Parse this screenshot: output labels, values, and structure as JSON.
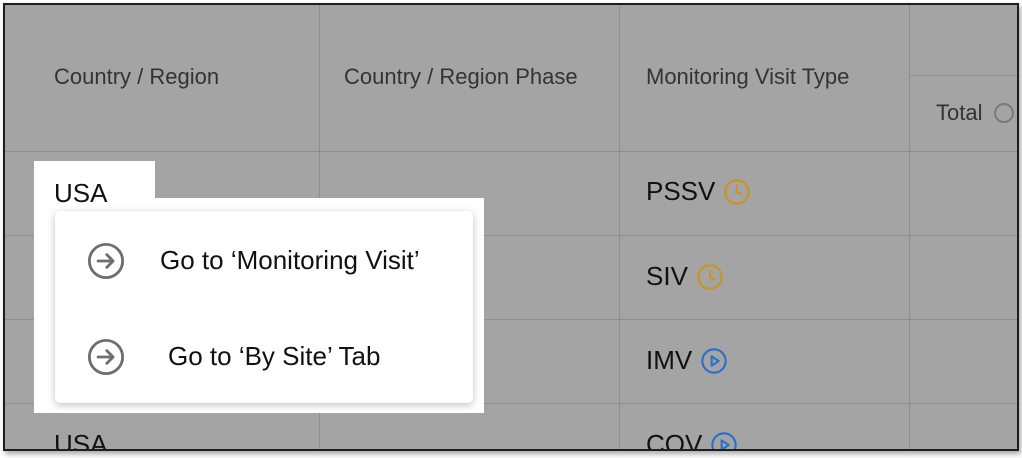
{
  "table": {
    "headers": {
      "country_region": "Country / Region",
      "country_region_phase": "Country / Region Phase",
      "monitoring_visit_type": "Monitoring Visit Type",
      "total": "Total"
    },
    "rows": [
      {
        "country": "USA",
        "visit_type": "PSSV",
        "status_icon": "clock-icon"
      },
      {
        "country": "",
        "visit_type": "SIV",
        "status_icon": "clock-icon"
      },
      {
        "country": "",
        "visit_type": "IMV",
        "status_icon": "play-circle-icon"
      },
      {
        "country": "USA",
        "visit_type": "COV",
        "status_icon": "play-circle-icon"
      }
    ]
  },
  "context_menu": {
    "items": [
      {
        "label": "Go to ‘Monitoring Visit’",
        "icon": "arrow-right-circle-icon"
      },
      {
        "label": "Go to ‘By Site’ Tab",
        "icon": "arrow-right-circle-icon"
      }
    ]
  },
  "colors": {
    "clock_icon": "#c8961e",
    "play_icon": "#2a6fc9",
    "menu_icon": "#6e6e6e",
    "overlay_gray": "#a4a4a4"
  }
}
